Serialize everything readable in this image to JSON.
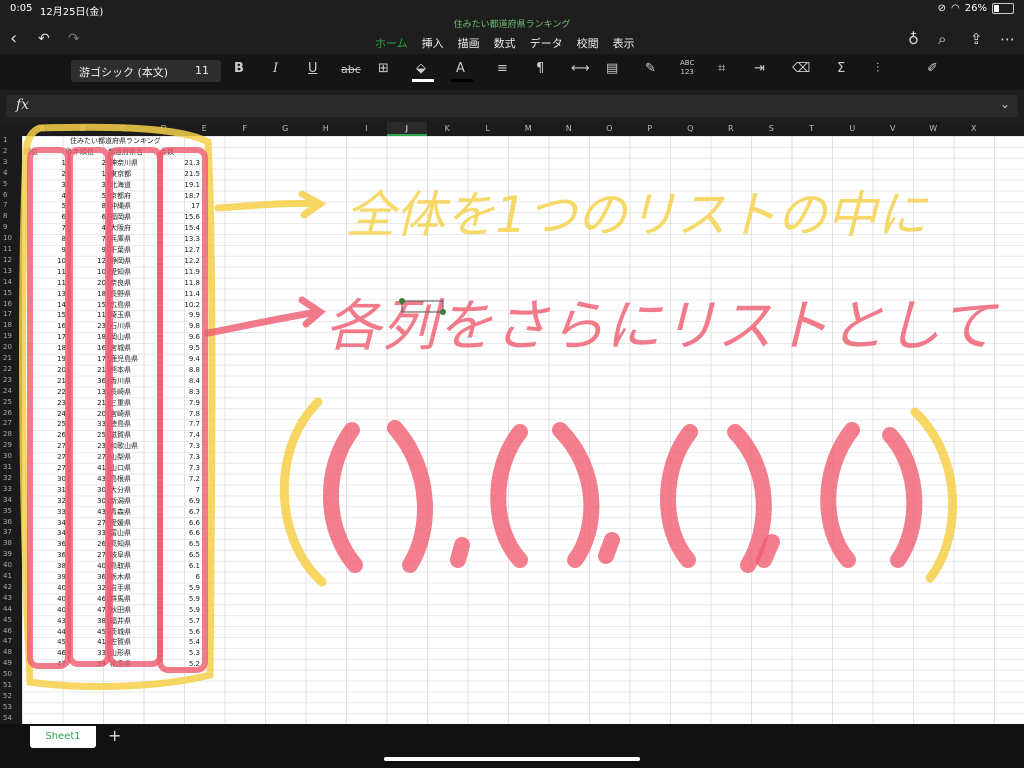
{
  "status": {
    "time": "0:05",
    "date": "12月25日(金)",
    "battery": "26%"
  },
  "document": {
    "title": "住みたい都道府県ランキング"
  },
  "tabs": [
    "ホーム",
    "挿入",
    "描画",
    "数式",
    "データ",
    "校閲",
    "表示"
  ],
  "ribbon": {
    "font_name": "游ゴシック (本文)",
    "font_size": "11",
    "bold": "B",
    "italic": "I",
    "underline": "U",
    "strike": "abc",
    "spell_top": "ABC",
    "spell_bottom": "123",
    "sum": "Σ"
  },
  "formula_bar": {
    "label": "fx",
    "value": ""
  },
  "columns": [
    "A",
    "B",
    "C",
    "D",
    "E",
    "F",
    "G",
    "H",
    "I",
    "J",
    "K",
    "L",
    "M",
    "N",
    "O",
    "P",
    "Q",
    "R",
    "S",
    "T",
    "U",
    "V",
    "W",
    "X"
  ],
  "selected_column": "J",
  "rows": [
    "1",
    "2",
    "3",
    "4",
    "5",
    "6",
    "7",
    "8",
    "9",
    "10",
    "11",
    "12",
    "13",
    "14",
    "15",
    "16",
    "17",
    "18",
    "19",
    "20",
    "21",
    "22",
    "23",
    "24",
    "25",
    "26",
    "27",
    "28",
    "29",
    "30",
    "31",
    "32",
    "33",
    "34",
    "35",
    "36",
    "37",
    "38",
    "39",
    "40",
    "41",
    "42",
    "43",
    "44",
    "45",
    "46",
    "47",
    "48",
    "49",
    "50",
    "51",
    "52",
    "53",
    "54"
  ],
  "sheet": {
    "title_cell": "住みたい都道府県ランキング",
    "headers": [
      "順位",
      "昨年順位",
      "都道府県名",
      "点数"
    ],
    "data": [
      [
        "1",
        "2",
        "神奈川県",
        "21.3"
      ],
      [
        "2",
        "1",
        "東京都",
        "21.5"
      ],
      [
        "3",
        "3",
        "北海道",
        "19.1"
      ],
      [
        "4",
        "5",
        "京都府",
        "18.7"
      ],
      [
        "5",
        "8",
        "沖縄県",
        "17"
      ],
      [
        "6",
        "6",
        "福岡県",
        "15.6"
      ],
      [
        "7",
        "4",
        "大阪府",
        "15.4"
      ],
      [
        "8",
        "7",
        "兵庫県",
        "13.3"
      ],
      [
        "9",
        "9",
        "千葉県",
        "12.7"
      ],
      [
        "10",
        "12",
        "静岡県",
        "12.2"
      ],
      [
        "11",
        "10",
        "愛知県",
        "11.9"
      ],
      [
        "11",
        "20",
        "奈良県",
        "11.8"
      ],
      [
        "13",
        "18",
        "長野県",
        "11.4"
      ],
      [
        "14",
        "15",
        "広島県",
        "10.2"
      ],
      [
        "15",
        "11",
        "埼玉県",
        "9.9"
      ],
      [
        "16",
        "23",
        "石川県",
        "9.8"
      ],
      [
        "17",
        "18",
        "岡山県",
        "9.6"
      ],
      [
        "18",
        "16",
        "宮城県",
        "9.5"
      ],
      [
        "19",
        "17",
        "鹿児島県",
        "9.4"
      ],
      [
        "20",
        "21",
        "熊本県",
        "8.8"
      ],
      [
        "21",
        "36",
        "香川県",
        "8.4"
      ],
      [
        "22",
        "13",
        "長崎県",
        "8.3"
      ],
      [
        "23",
        "21",
        "三重県",
        "7.9"
      ],
      [
        "24",
        "20",
        "宮崎県",
        "7.8"
      ],
      [
        "25",
        "33",
        "徳島県",
        "7.7"
      ],
      [
        "26",
        "25",
        "滋賀県",
        "7.4"
      ],
      [
        "27",
        "23",
        "和歌山県",
        "7.3"
      ],
      [
        "27",
        "27",
        "山梨県",
        "7.3"
      ],
      [
        "27",
        "41",
        "山口県",
        "7.3"
      ],
      [
        "30",
        "43",
        "島根県",
        "7.2"
      ],
      [
        "31",
        "30",
        "大分県",
        "7"
      ],
      [
        "32",
        "30",
        "新潟県",
        "6.9"
      ],
      [
        "33",
        "43",
        "青森県",
        "6.7"
      ],
      [
        "34",
        "27",
        "愛媛県",
        "6.6"
      ],
      [
        "34",
        "33",
        "富山県",
        "6.6"
      ],
      [
        "36",
        "26",
        "高知県",
        "6.5"
      ],
      [
        "36",
        "27",
        "岐阜県",
        "6.5"
      ],
      [
        "38",
        "40",
        "鳥取県",
        "6.1"
      ],
      [
        "39",
        "36",
        "栃木県",
        "6"
      ],
      [
        "40",
        "32",
        "岩手県",
        "5.9"
      ],
      [
        "40",
        "46",
        "群馬県",
        "5.9"
      ],
      [
        "40",
        "47",
        "秋田県",
        "5.9"
      ],
      [
        "43",
        "38",
        "福井県",
        "5.7"
      ],
      [
        "44",
        "45",
        "茨城県",
        "5.6"
      ],
      [
        "45",
        "41",
        "佐賀県",
        "5.4"
      ],
      [
        "46",
        "33",
        "山形県",
        "5.3"
      ],
      [
        "47",
        "39",
        "福島県",
        "5.2"
      ]
    ]
  },
  "annotations": {
    "line1": "全体を1つのリストの中に",
    "line2": "各列をさらにリストとして"
  },
  "sheets": [
    "Sheet1"
  ],
  "add_sheet": "+"
}
